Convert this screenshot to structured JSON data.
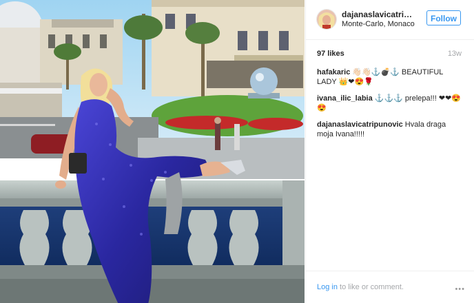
{
  "post": {
    "username": "dajanaslavicatripunovic",
    "location": "Monte-Carlo, Monaco",
    "follow_label": "Follow",
    "likes": "97 likes",
    "time": "13w"
  },
  "comments": [
    {
      "user": "hafakaric",
      "text": "👋🏻👋🏻⚓💣⚓ BEAUTIFUL LADY 👑❤😍🌹"
    },
    {
      "user": "ivana_ilic_labia",
      "text": "⚓⚓⚓ prelepa!!! ❤❤😍😍"
    },
    {
      "user": "dajanaslavicatripunovic",
      "text": "Hvala draga moja Ivana!!!!!"
    }
  ],
  "footer": {
    "login_link": "Log in",
    "login_rest": " to like or comment.",
    "more": "•••"
  },
  "colors": {
    "accent": "#3897f0",
    "text": "#262626",
    "muted": "#a5a7aa",
    "dress": "#2c2aa8"
  },
  "icons": {
    "more": "more-options-icon"
  }
}
